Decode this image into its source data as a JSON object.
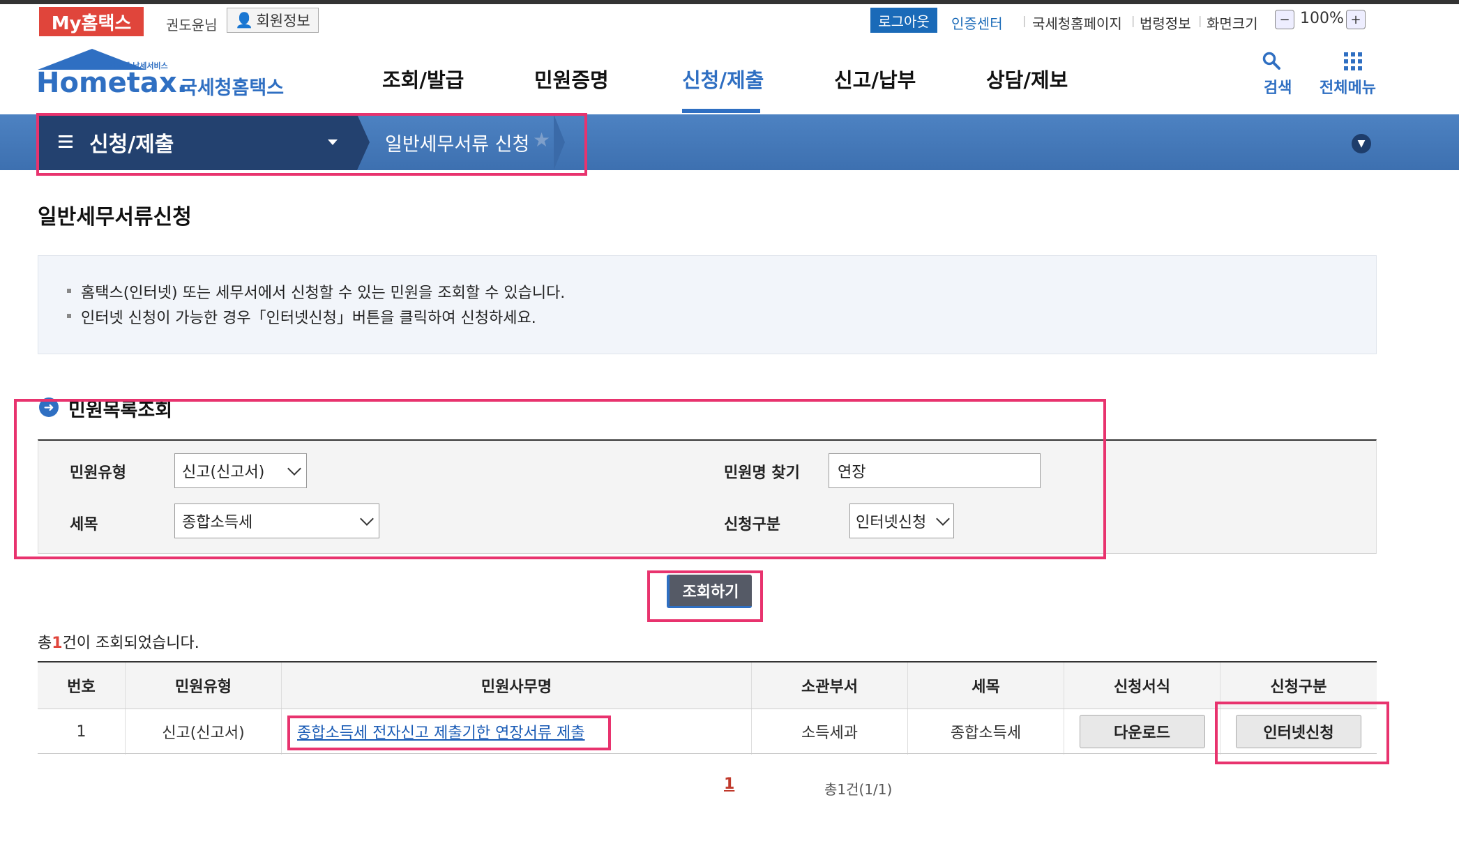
{
  "topbar": {
    "my_hometax": "My홈택스",
    "user_name": "권도윤님",
    "member_info": "회원정보",
    "logout": "로그아웃",
    "cert_center": "인증센터",
    "links": [
      "국세청홈페이지",
      "법령정보",
      "화면크기"
    ],
    "zoom_minus": "−",
    "zoom_value": "100%",
    "zoom_plus": "+"
  },
  "header": {
    "logo_tag": "인터넷 납세서비스",
    "logo_text": "Hometax.",
    "logo_kr": "국세청홈택스",
    "nav": [
      "조회/발급",
      "민원증명",
      "신청/제출",
      "신고/납부",
      "상담/제보"
    ],
    "active_nav": "신청/제출",
    "search_label": "검색",
    "all_menu_label": "전체메뉴"
  },
  "breadcrumb": {
    "section": "신청/제출",
    "page": "일반세무서류 신청"
  },
  "page_title": "일반세무서류신청",
  "info": {
    "lines": [
      "홈택스(인터넷) 또는 세무서에서 신청할 수 있는 민원을 조회할 수 있습니다.",
      "인터넷 신청이 가능한 경우「인터넷신청」버튼을 클릭하여 신청하세요."
    ]
  },
  "search_form": {
    "section_title": "민원목록조회",
    "complaint_type_label": "민원유형",
    "complaint_type_value": "신고(신고서)",
    "complaint_name_label": "민원명 찾기",
    "complaint_name_value": "연장",
    "tax_item_label": "세목",
    "tax_item_value": "종합소득세",
    "apply_type_label": "신청구분",
    "apply_type_value": "인터넷신청",
    "query_button": "조회하기"
  },
  "result": {
    "prefix": "총",
    "count": "1",
    "suffix": "건이 조회되었습니다."
  },
  "table": {
    "headers": [
      "번호",
      "민원유형",
      "민원사무명",
      "소관부서",
      "세목",
      "신청서식",
      "신청구분"
    ],
    "rows": [
      {
        "no": "1",
        "type": "신고(신고서)",
        "name": "종합소득세 전자신고 제출기한 연장서류 제출",
        "dept": "소득세과",
        "tax": "종합소득세",
        "form_button": "다운로드",
        "apply_button": "인터넷신청"
      }
    ]
  },
  "pagination": {
    "current": "1",
    "total": "총1건(1/1)"
  },
  "colors": {
    "brand_blue": "#2f6fc2",
    "breadcrumb_dark": "#23416f",
    "highlight_red": "#e8336e",
    "my_hometax_red": "#e0453b"
  }
}
